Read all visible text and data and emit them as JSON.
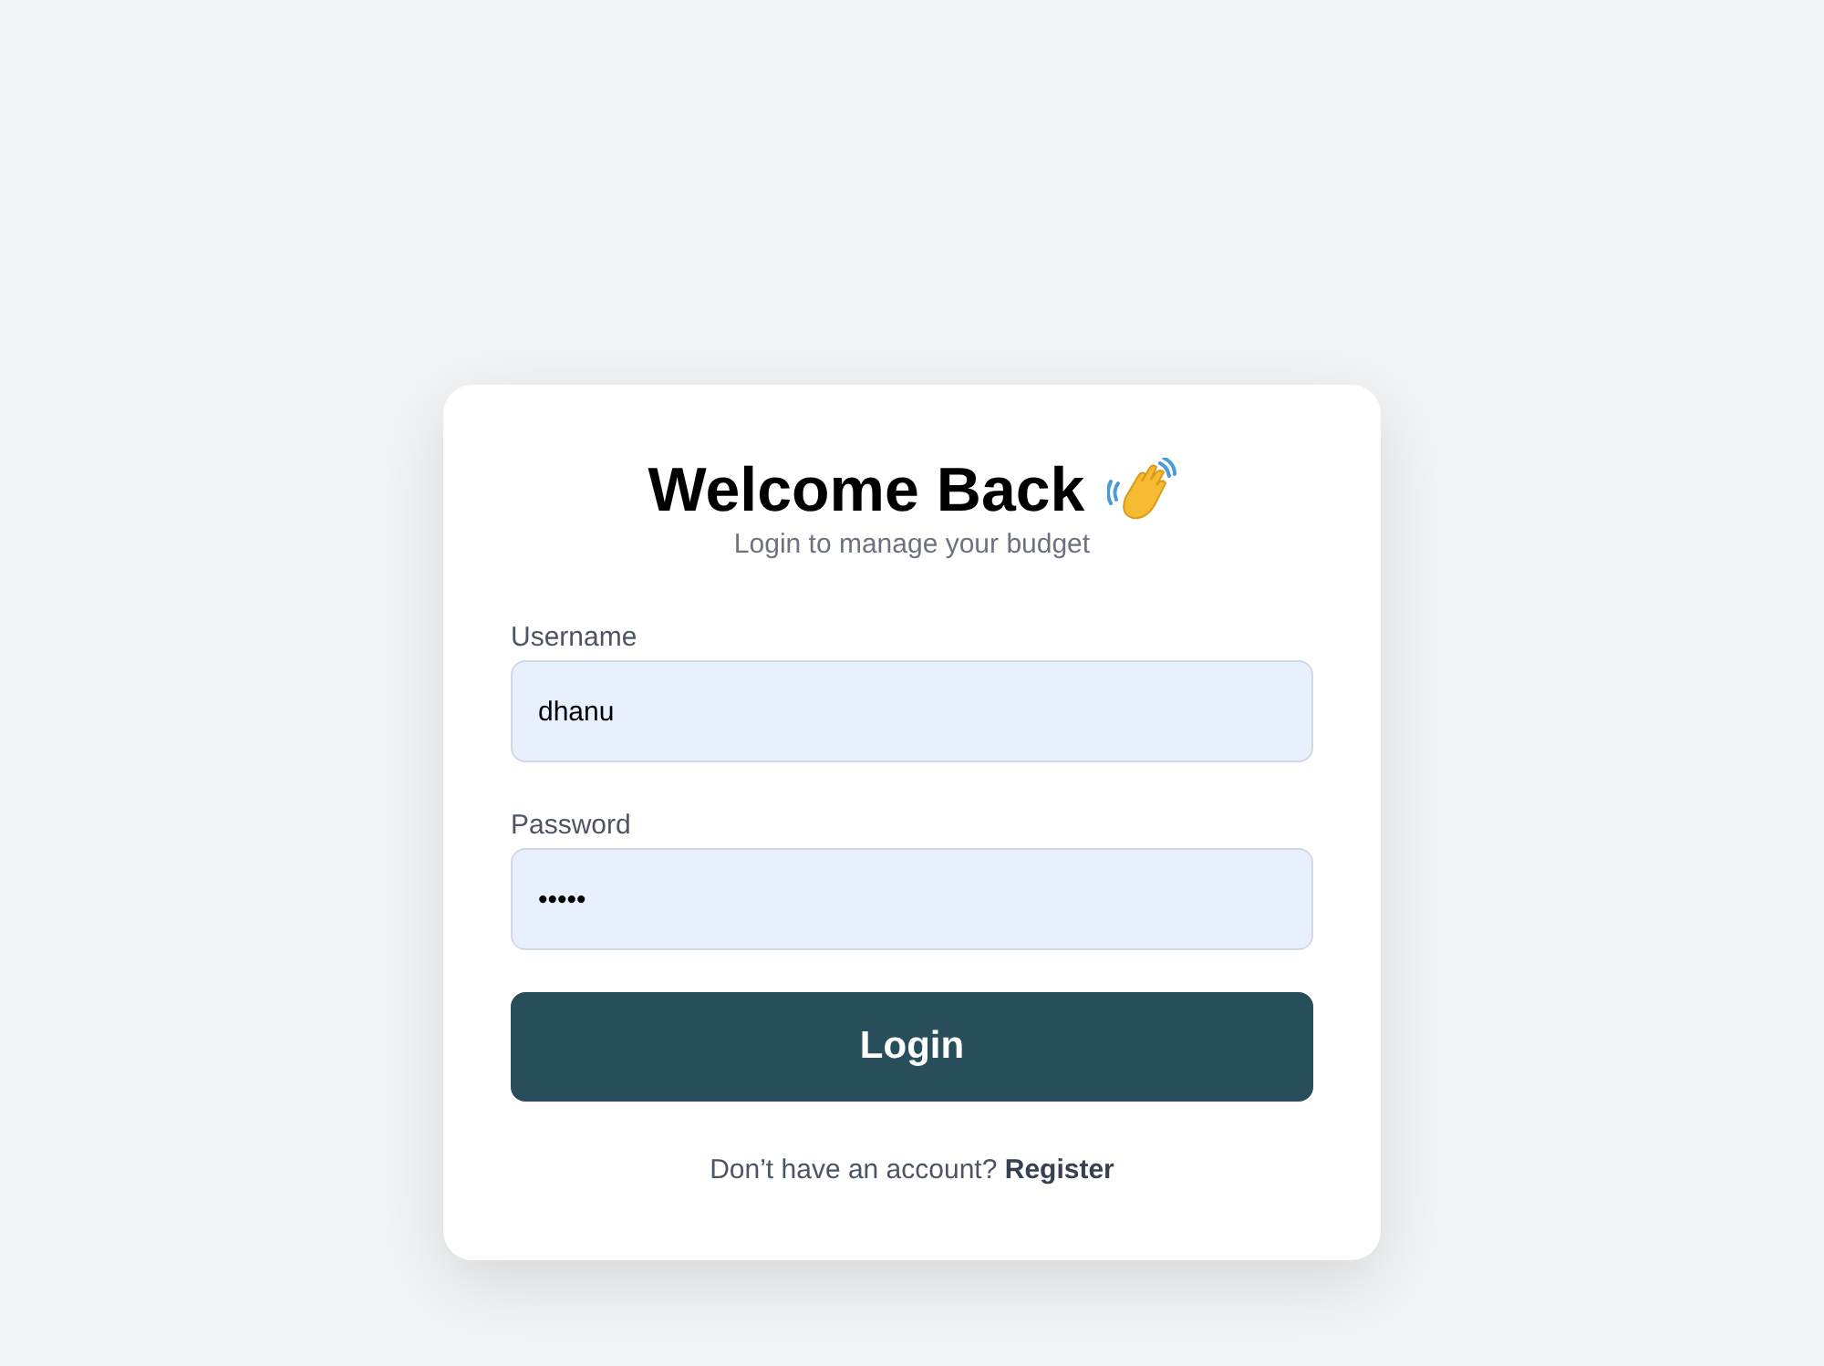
{
  "card": {
    "title": "Welcome Back",
    "subtitle": "Login to manage your budget",
    "fields": [
      {
        "label": "Username",
        "value": "dhanu"
      },
      {
        "label": "Password",
        "value": "•••••"
      }
    ],
    "submit_button": "Login",
    "footer": {
      "text": "Don’t have an account?",
      "link": "Register"
    }
  }
}
